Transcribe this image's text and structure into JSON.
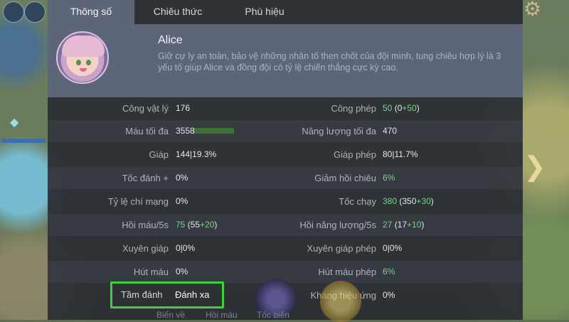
{
  "tabs": [
    {
      "label": "Thông số",
      "active": true
    },
    {
      "label": "Chiêu thức",
      "active": false
    },
    {
      "label": "Phù hiệu",
      "active": false
    }
  ],
  "hero": {
    "name": "Alice",
    "description": "Giữ cự ly an toàn, bảo vệ những nhân tố then chốt của đội mình, tung chiêu hợp lý là 3 yếu tố giúp Alice và đồng đội có tỷ lệ chiến thắng cực kỳ cao."
  },
  "stats_left": [
    {
      "label": "Công vật lý",
      "value": "176"
    },
    {
      "label": "Máu tối đa",
      "value": "3558"
    },
    {
      "label": "Giáp",
      "value": "144|19.3%"
    },
    {
      "label": "Tốc đánh +",
      "value": "0%"
    },
    {
      "label": "Tỷ lệ chí mạng",
      "value": "0%"
    },
    {
      "label": "Hồi máu/5s",
      "value_main": "75",
      "value_open": " (55",
      "value_bonus": "+20",
      "value_close": ")"
    },
    {
      "label": "Xuyên giáp",
      "value": "0|0%"
    },
    {
      "label": "Hút máu",
      "value": "0%"
    }
  ],
  "stats_right": [
    {
      "label": "Công phép",
      "value_main": "50",
      "value_open": " (0",
      "value_bonus": "+50",
      "value_close": ")"
    },
    {
      "label": "Năng lượng tối đa",
      "value": "470"
    },
    {
      "label": "Giáp phép",
      "value": "80|11.7%"
    },
    {
      "label": "Giảm hồi chiêu",
      "value_green": "6%"
    },
    {
      "label": "Tốc chạy",
      "value_main": "380",
      "value_open": " (350",
      "value_bonus": "+30",
      "value_close": ")"
    },
    {
      "label": "Hồi năng lượng/5s",
      "value_main": "27",
      "value_open": " (17",
      "value_bonus": "+10",
      "value_close": ")"
    },
    {
      "label": "Xuyên giáp phép",
      "value": "0|0%"
    },
    {
      "label": "Hút máu phép",
      "value_green": "6%"
    },
    {
      "label": "Kháng hiệu ứng",
      "value": "0%"
    }
  ],
  "range": {
    "label": "Tầm đánh",
    "value": "Đánh xa"
  },
  "bottom_bar": [
    "Biến về",
    "Hồi máu",
    "Tốc biến"
  ],
  "colors": {
    "accent_green": "#74d58a",
    "highlight_box": "#3cd23c",
    "header_bg": "#5d6679"
  }
}
